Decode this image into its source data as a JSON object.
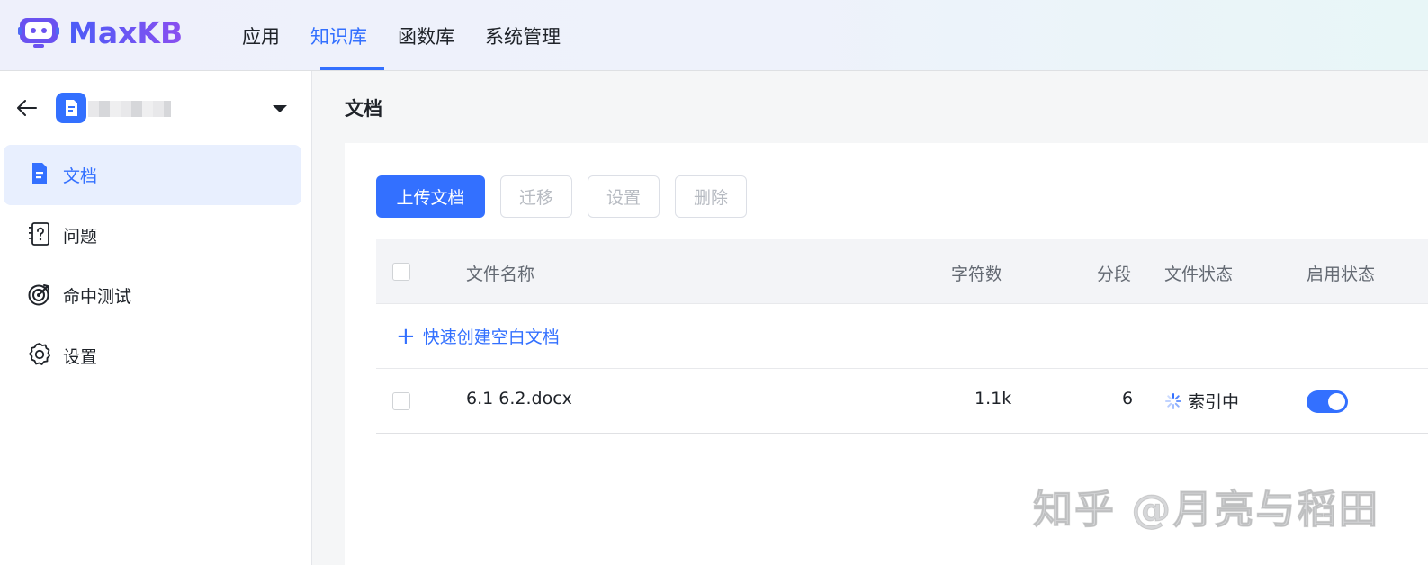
{
  "brand": {
    "name": "MaxKB"
  },
  "nav": {
    "items": [
      {
        "label": "应用"
      },
      {
        "label": "知识库",
        "active": true
      },
      {
        "label": "函数库"
      },
      {
        "label": "系统管理"
      }
    ]
  },
  "sidebar": {
    "kb_name": "",
    "items": [
      {
        "label": "文档",
        "icon": "document-icon",
        "active": true
      },
      {
        "label": "问题",
        "icon": "question-icon"
      },
      {
        "label": "命中测试",
        "icon": "target-icon"
      },
      {
        "label": "设置",
        "icon": "gear-icon"
      }
    ]
  },
  "main": {
    "title": "文档",
    "toolbar": {
      "upload_label": "上传文档",
      "move_label": "迁移",
      "settings_label": "设置",
      "delete_label": "删除"
    },
    "table": {
      "columns": [
        "文件名称",
        "字符数",
        "分段",
        "文件状态",
        "启用状态"
      ],
      "quick_create_label": "快速创建空白文档",
      "rows": [
        {
          "name": "6.1 6.2.docx",
          "chars": "1.1k",
          "segments": "6",
          "status": "索引中",
          "enabled": true
        }
      ]
    }
  },
  "watermark": "知乎 @月亮与稻田",
  "colors": {
    "accent": "#3370ff",
    "brand_start": "#4a5cf7",
    "brand_end": "#8a4ff0"
  }
}
